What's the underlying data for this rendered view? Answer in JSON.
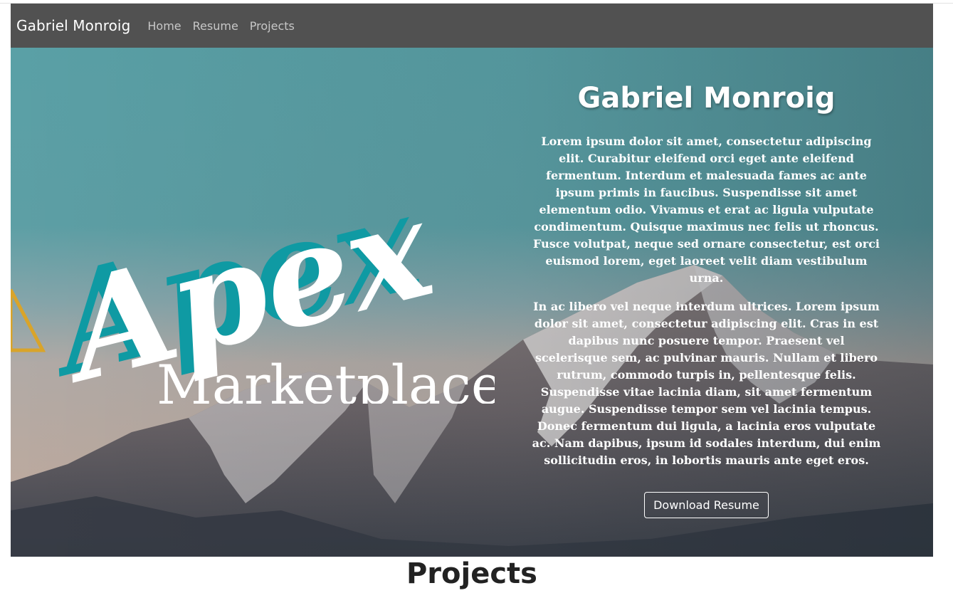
{
  "navbar": {
    "brand": "Gabriel Monroig",
    "links": [
      "Home",
      "Resume",
      "Projects"
    ]
  },
  "hero": {
    "logo_script": "Apex",
    "logo_sub": "Marketplace",
    "title": "Gabriel Monroig",
    "paragraphs": [
      "Lorem ipsum dolor sit amet, consectetur adipiscing elit. Curabitur eleifend orci eget ante eleifend fermentum. Interdum et malesuada fames ac ante ipsum primis in faucibus. Suspendisse sit amet elementum odio. Vivamus et erat ac ligula vulputate condimentum. Quisque maximus nec felis ut rhoncus. Fusce volutpat, neque sed ornare consectetur, est orci euismod lorem, eget laoreet velit diam vestibulum urna.",
      "In ac libero vel neque interdum ultrices. Lorem ipsum dolor sit amet, consectetur adipiscing elit. Cras in est dapibus nunc posuere tempor. Praesent vel scelerisque sem, ac pulvinar mauris. Nullam et libero rutrum, commodo turpis in, pellentesque felis. Suspendisse vitae lacinia diam, sit amet fermentum augue. Suspendisse tempor sem vel lacinia tempus. Donec fermentum dui ligula, a lacinia eros vulputate ac. Nam dapibus, ipsum id sodales interdum, dui enim sollicitudin eros, in lobortis mauris ante eget eros."
    ],
    "button": "Download Resume"
  },
  "projects": {
    "heading": "Projects"
  },
  "colors": {
    "navbar_bg": "#515151",
    "logo_teal": "#0f9aa3",
    "logo_triangle": "#d9a42a"
  }
}
